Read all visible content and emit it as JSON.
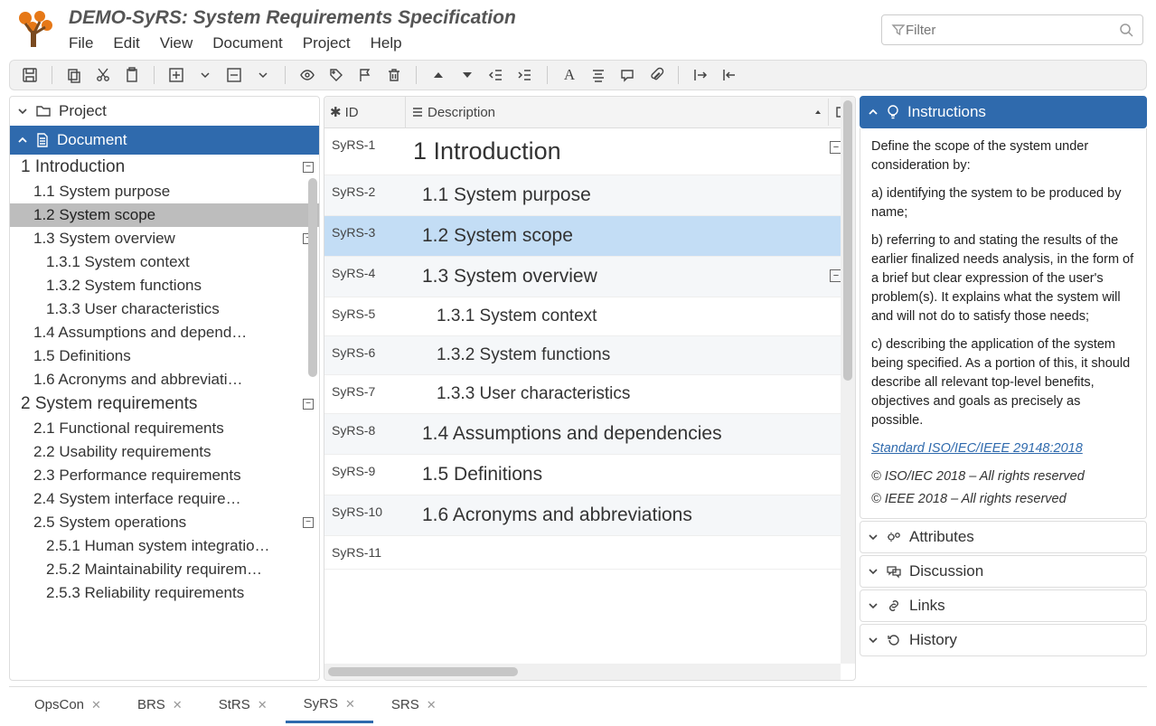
{
  "title": "DEMO-SyRS: System Requirements Specification",
  "menu": [
    "File",
    "Edit",
    "View",
    "Document",
    "Project",
    "Help"
  ],
  "filter_placeholder": "Filter",
  "left": {
    "project_label": "Project",
    "document_label": "Document",
    "tree": [
      {
        "lvl": 1,
        "label": "1 Introduction",
        "collapse": "−"
      },
      {
        "lvl": 2,
        "label": "1.1 System purpose"
      },
      {
        "lvl": 2,
        "label": "1.2 System scope",
        "sel": true
      },
      {
        "lvl": 2,
        "label": "1.3 System overview",
        "collapse": "−"
      },
      {
        "lvl": 3,
        "label": "1.3.1 System context"
      },
      {
        "lvl": 3,
        "label": "1.3.2 System functions"
      },
      {
        "lvl": 3,
        "label": "1.3.3 User characteristics"
      },
      {
        "lvl": 2,
        "label": "1.4 Assumptions and depend…"
      },
      {
        "lvl": 2,
        "label": "1.5 Definitions"
      },
      {
        "lvl": 2,
        "label": "1.6 Acronyms and abbreviati…"
      },
      {
        "lvl": 1,
        "label": "2 System requirements",
        "collapse": "−"
      },
      {
        "lvl": 2,
        "label": "2.1 Functional requirements"
      },
      {
        "lvl": 2,
        "label": "2.2 Usability requirements"
      },
      {
        "lvl": 2,
        "label": "2.3 Performance requirements"
      },
      {
        "lvl": 2,
        "label": "2.4 System interface require…"
      },
      {
        "lvl": 2,
        "label": "2.5 System operations",
        "collapse": "−"
      },
      {
        "lvl": 3,
        "label": "2.5.1 Human system integratio…"
      },
      {
        "lvl": 3,
        "label": "2.5.2 Maintainability requirem…"
      },
      {
        "lvl": 3,
        "label": "2.5.3 Reliability requirements"
      }
    ]
  },
  "grid": {
    "col_id": "ID",
    "col_desc": "Description",
    "rows": [
      {
        "id": "SyRS-1",
        "desc": "1 Introduction",
        "h": "h1",
        "expand": "−"
      },
      {
        "id": "SyRS-2",
        "desc": "1.1 System purpose",
        "h": "h2",
        "alt": true
      },
      {
        "id": "SyRS-3",
        "desc": "1.2 System scope",
        "h": "h2",
        "sel": true
      },
      {
        "id": "SyRS-4",
        "desc": "1.3 System overview",
        "h": "h2",
        "alt": true,
        "expand": "−"
      },
      {
        "id": "SyRS-5",
        "desc": "1.3.1 System context",
        "h": "h3"
      },
      {
        "id": "SyRS-6",
        "desc": "1.3.2 System functions",
        "h": "h3",
        "alt": true
      },
      {
        "id": "SyRS-7",
        "desc": "1.3.3 User characteristics",
        "h": "h3"
      },
      {
        "id": "SyRS-8",
        "desc": "1.4 Assumptions and dependencies",
        "h": "h2",
        "alt": true
      },
      {
        "id": "SyRS-9",
        "desc": "1.5 Definitions",
        "h": "h2"
      },
      {
        "id": "SyRS-10",
        "desc": "1.6 Acronyms and abbreviations",
        "h": "h2",
        "alt": true
      },
      {
        "id": "SyRS-11",
        "desc": "",
        "h": "h1"
      }
    ]
  },
  "tabs": [
    {
      "label": "OpsCon"
    },
    {
      "label": "BRS"
    },
    {
      "label": "StRS"
    },
    {
      "label": "SyRS",
      "active": true
    },
    {
      "label": "SRS"
    }
  ],
  "right": {
    "instructions_title": "Instructions",
    "p1": "Define the scope of the system under consideration by:",
    "p2": "a) identifying the system to be produced by name;",
    "p3": "b) referring to and stating the results of the earlier finalized needs analysis, in the form of a brief but clear expression of the user's problem(s). It explains what the system will and will not do to satisfy those needs;",
    "p4": "c) describing the application of the system being specified. As a portion of this, it should describe all relevant top-level benefits, objectives and goals as precisely as possible.",
    "link": "Standard ISO/IEC/IEEE 29148:2018",
    "copy1": "© ISO/IEC 2018 – All rights reserved",
    "copy2": "© IEEE 2018 – All rights reserved",
    "attributes": "Attributes",
    "discussion": "Discussion",
    "links": "Links",
    "history": "History"
  }
}
